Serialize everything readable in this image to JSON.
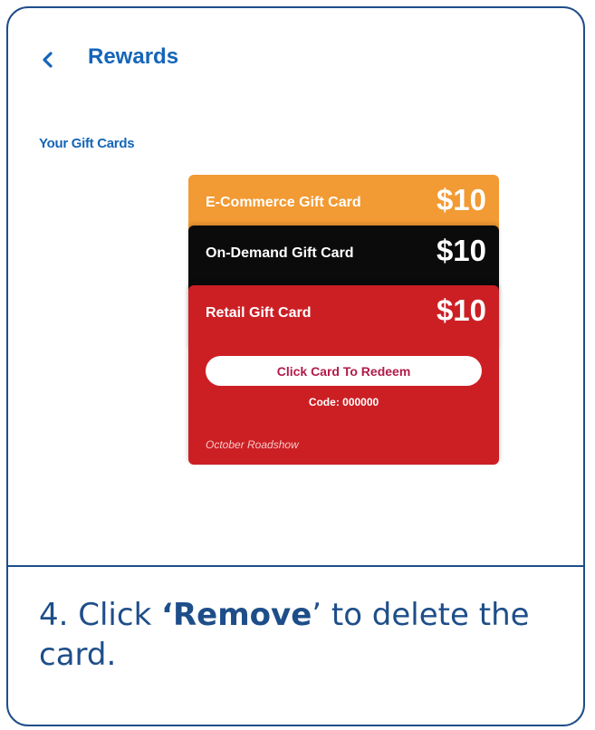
{
  "header": {
    "back_icon": "chevron-left-icon",
    "title": "Rewards"
  },
  "section": {
    "title": "Your Gift Cards"
  },
  "cards": [
    {
      "name": "E-Commerce Gift Card",
      "amount": "$10",
      "color": "#f29a33"
    },
    {
      "name": "On-Demand Gift Card",
      "amount": "$10",
      "color": "#0b0b0b"
    },
    {
      "name": "Retail Gift Card",
      "amount": "$10",
      "color": "#cc1f24",
      "redeem_label": "Click Card To Redeem",
      "code": "Code: 000000",
      "event": "October Roadshow"
    }
  ],
  "instruction": {
    "prefix": "4. Click ",
    "open_quote": "‘",
    "keyword": "Remove",
    "close_quote": "’",
    "suffix": " to delete the card."
  },
  "colors": {
    "brand_blue": "#1565b9",
    "frame_navy": "#1e4e89",
    "redeem_text": "#b21a4a"
  }
}
